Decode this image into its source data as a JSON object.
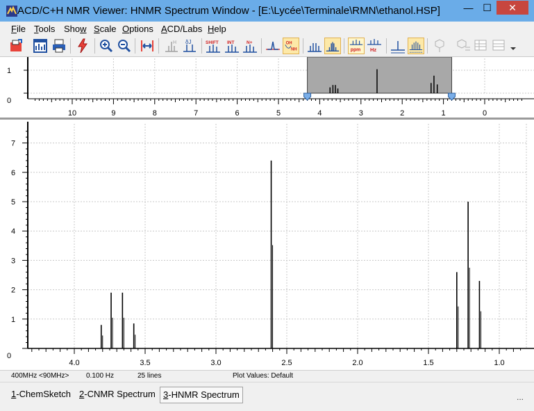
{
  "window": {
    "title": "ACD/C+H NMR Viewer: HNMR Spectrum Window - [E:\\Lycée\\Terminale\\RMN\\ethanol.HSP]",
    "minimize_glyph": "—",
    "maximize_glyph": "☐",
    "close_glyph": "✕"
  },
  "menu": [
    {
      "key": "F",
      "rest": "ile"
    },
    {
      "key": "T",
      "rest": "ools"
    },
    {
      "key": "Sho",
      "rest": "w",
      "underline_last": true
    },
    {
      "key": "S",
      "rest": "cale"
    },
    {
      "key": "O",
      "rest": "ptions"
    },
    {
      "key": "A",
      "rest": "CD/Labs"
    },
    {
      "key": "H",
      "rest": "elp"
    }
  ],
  "toolbar_buttons": [
    "open-icon",
    "chart-window-icon",
    "print-icon",
    "lightning-icon",
    "zoom-in-icon",
    "zoom-out-icon",
    "full-range-icon",
    "peak-h-icon",
    "coupling-j-icon",
    "shift-label-icon",
    "integral-label-icon",
    "proton-count-icon",
    "baseline-icon",
    "oh-nh-icon",
    "peaks-icon",
    "multiplet-icon",
    "ppm-unit-icon",
    "hz-unit-icon",
    "spectrum-view-icon",
    "scaled-spectrum-icon",
    "structure-gray-icon",
    "assign-gray-icon",
    "table-gray-icon",
    "more-dropdown-icon"
  ],
  "toolbar_text": {
    "shift": "SHIFT",
    "int": "INT",
    "nplus": "N+",
    "oh": "OH",
    "nh": "NH",
    "ppm": "ppm",
    "hz": "Hz"
  },
  "overview": {
    "y_ticks": [
      "1",
      "0"
    ],
    "x_ticks": [
      "10",
      "9",
      "8",
      "7",
      "6",
      "5",
      "4",
      "3",
      "2",
      "1",
      "0"
    ],
    "zoom_window_ppm": [
      4.3,
      0.8
    ],
    "peaks_ppm": [
      {
        "ppm": 3.75,
        "h": 0.2
      },
      {
        "ppm": 3.68,
        "h": 0.28
      },
      {
        "ppm": 3.62,
        "h": 0.28
      },
      {
        "ppm": 3.56,
        "h": 0.16
      },
      {
        "ppm": 2.61,
        "h": 0.82
      },
      {
        "ppm": 1.3,
        "h": 0.35
      },
      {
        "ppm": 1.23,
        "h": 0.6
      },
      {
        "ppm": 1.15,
        "h": 0.3
      }
    ]
  },
  "chart_data": {
    "type": "line",
    "title": "",
    "xlabel": "",
    "ylabel": "",
    "x_ticks": [
      "4.0",
      "3.5",
      "3.0",
      "2.5",
      "2.0",
      "1.5",
      "1.0"
    ],
    "y_ticks": [
      "0",
      "1",
      "2",
      "3",
      "4",
      "5",
      "6",
      "7"
    ],
    "xlim": [
      4.2,
      0.9
    ],
    "ylim": [
      0,
      7.6
    ],
    "x_reversed": true,
    "grid": true,
    "series": [
      {
        "points": [
          {
            "x": 3.81,
            "y": 0.8
          },
          {
            "x": 3.74,
            "y": 1.9
          },
          {
            "x": 3.66,
            "y": 1.9
          },
          {
            "x": 3.58,
            "y": 0.85
          },
          {
            "x": 2.61,
            "y": 6.4
          },
          {
            "x": 1.3,
            "y": 2.6
          },
          {
            "x": 1.22,
            "y": 5.0
          },
          {
            "x": 1.14,
            "y": 2.3
          }
        ]
      }
    ]
  },
  "status": {
    "frequency": "400MHz <90MHz>",
    "resolution": "0.100 Hz",
    "lines": "25 lines",
    "plot_values": "Plot Values: Default"
  },
  "tabs": [
    {
      "num": "1",
      "label": "-ChemSketch",
      "active": false
    },
    {
      "num": "2",
      "label": "-CNMR Spectrum",
      "active": false
    },
    {
      "num": "3",
      "label": "-HNMR Spectrum",
      "active": true
    }
  ],
  "tab_overflow": "..."
}
